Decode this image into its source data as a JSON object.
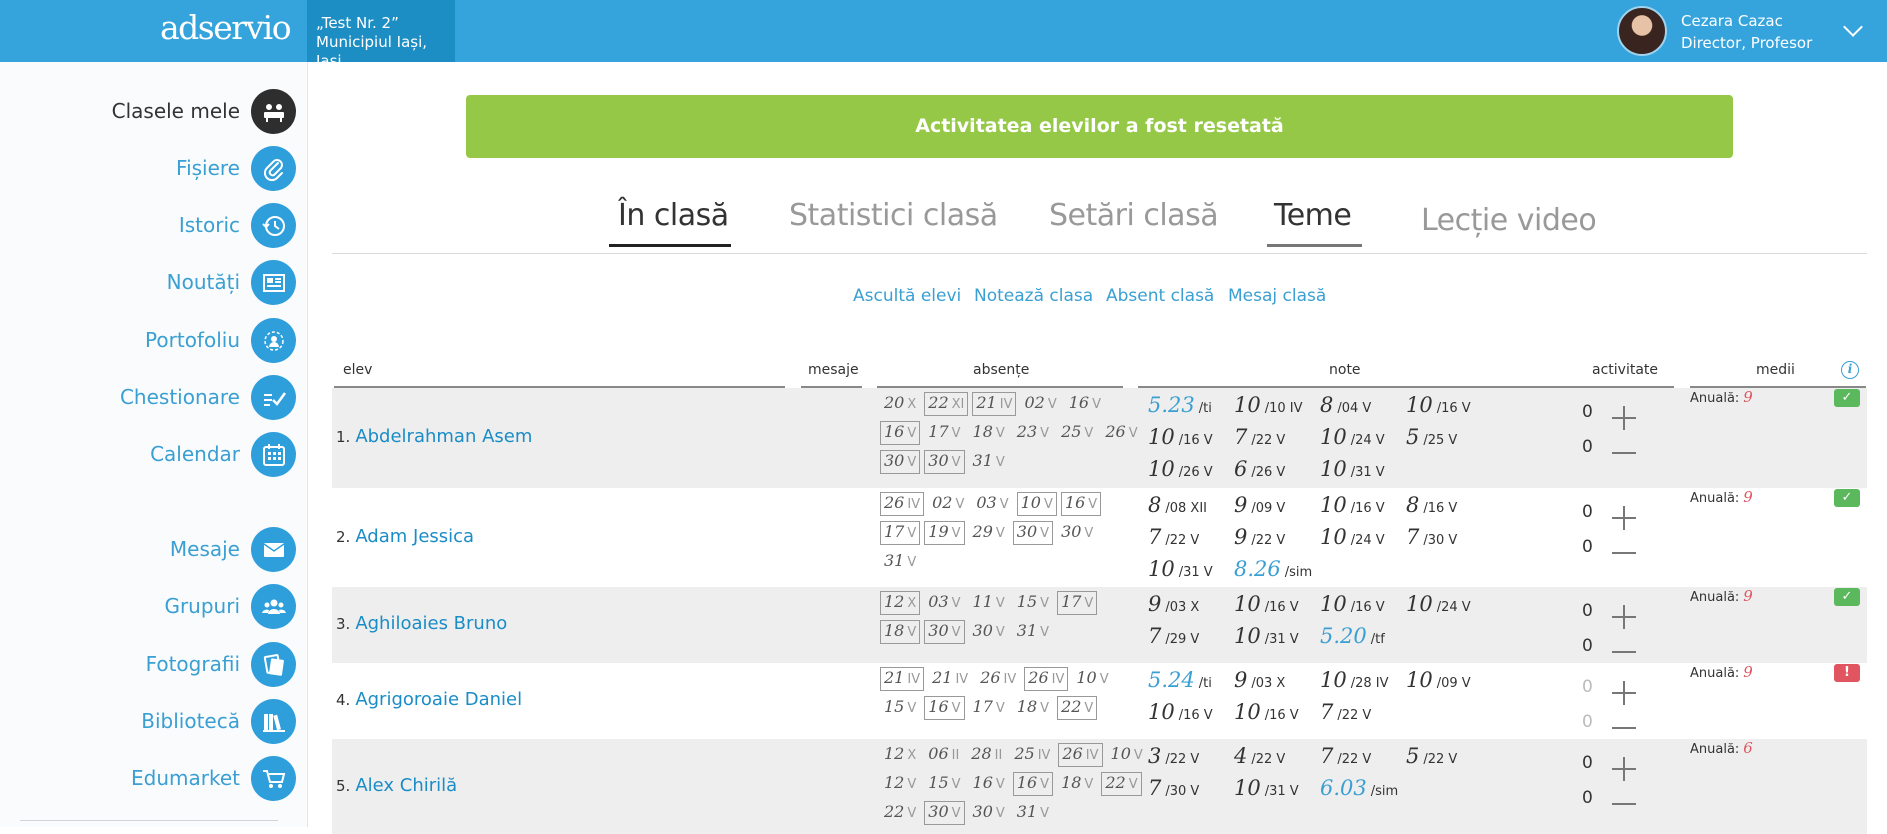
{
  "app": {
    "logo": "adservio",
    "school_line1": "„Test Nr. 2”",
    "school_line2": "Municipiul Iași, Iași"
  },
  "user": {
    "name": "Cezara Cazac",
    "role": "Director, Profesor"
  },
  "sidebar": {
    "items": [
      {
        "label": "Clasele mele",
        "icon": "classes-icon",
        "active": true
      },
      {
        "label": "Fișiere",
        "icon": "paperclip-icon"
      },
      {
        "label": "Istoric",
        "icon": "history-icon"
      },
      {
        "label": "Noutăți",
        "icon": "news-icon"
      },
      {
        "label": "Portofoliu",
        "icon": "portfolio-icon"
      },
      {
        "label": "Chestionare",
        "icon": "questionnaire-icon"
      },
      {
        "label": "Calendar",
        "icon": "calendar-icon"
      },
      {
        "label": "Mesaje",
        "icon": "envelope-icon"
      },
      {
        "label": "Grupuri",
        "icon": "group-icon"
      },
      {
        "label": "Fotografii",
        "icon": "photos-icon"
      },
      {
        "label": "Bibliotecă",
        "icon": "library-icon"
      },
      {
        "label": "Edumarket",
        "icon": "cart-icon"
      }
    ]
  },
  "banner": "Activitatea elevilor a fost resetată",
  "tabs": [
    "În clasă",
    "Statistici clasă",
    "Setări clasă",
    "Teme",
    "Lecție video"
  ],
  "actions": [
    "Ascultă elevi",
    "Notează clasa",
    "Absent clasă",
    "Mesaj clasă"
  ],
  "table": {
    "headers": {
      "elev": "elev",
      "mesaje": "mesaje",
      "absente": "absențe",
      "note": "note",
      "activitate": "activitate",
      "medii": "medii"
    }
  },
  "colors": {
    "accent": "#35a4dc",
    "success": "#95c847",
    "warning": "#e05560"
  },
  "students": [
    {
      "index": "1.",
      "name": "Abdelrahman Asem",
      "absences": [
        [
          {
            "d": "20",
            "m": "X",
            "b": false
          },
          {
            "d": "22",
            "m": "XI",
            "b": true
          },
          {
            "d": "21",
            "m": "IV",
            "b": true
          },
          {
            "d": "02",
            "m": "V",
            "b": false
          },
          {
            "d": "16",
            "m": "V",
            "b": false
          }
        ],
        [
          {
            "d": "16",
            "m": "V",
            "b": true
          },
          {
            "d": "17",
            "m": "V",
            "b": false
          },
          {
            "d": "18",
            "m": "V",
            "b": false
          },
          {
            "d": "23",
            "m": "V",
            "b": false
          },
          {
            "d": "25",
            "m": "V",
            "b": false
          },
          {
            "d": "26",
            "m": "V",
            "b": false
          }
        ],
        [
          {
            "d": "30",
            "m": "V",
            "b": true
          },
          {
            "d": "30",
            "m": "V",
            "b": true
          },
          {
            "d": "31",
            "m": "V",
            "b": false
          }
        ]
      ],
      "grades": [
        [
          {
            "v": "5.23",
            "s": "/ti",
            "blue": true
          },
          {
            "v": "10",
            "s": "/10 IV"
          },
          {
            "v": "8",
            "s": "/04 V"
          },
          {
            "v": "10",
            "s": "/16 V"
          }
        ],
        [
          {
            "v": "10",
            "s": "/16 V"
          },
          {
            "v": "7",
            "s": "/22 V"
          },
          {
            "v": "10",
            "s": "/24 V"
          },
          {
            "v": "5",
            "s": "/25 V"
          }
        ],
        [
          {
            "v": "10",
            "s": "/26 V"
          },
          {
            "v": "6",
            "s": "/26 V"
          },
          {
            "v": "10",
            "s": "/31 V"
          }
        ]
      ],
      "activity": [
        "0",
        "0"
      ],
      "activity_dim": false,
      "media_label": "Anuală:",
      "media": "9",
      "status": "ok"
    },
    {
      "index": "2.",
      "name": "Adam Jessica",
      "absences": [
        [
          {
            "d": "26",
            "m": "IV",
            "b": true
          },
          {
            "d": "02",
            "m": "V",
            "b": false
          },
          {
            "d": "03",
            "m": "V",
            "b": false
          },
          {
            "d": "10",
            "m": "V",
            "b": true
          },
          {
            "d": "16",
            "m": "V",
            "b": true
          }
        ],
        [
          {
            "d": "17",
            "m": "V",
            "b": true
          },
          {
            "d": "19",
            "m": "V",
            "b": true
          },
          {
            "d": "29",
            "m": "V",
            "b": false
          },
          {
            "d": "30",
            "m": "V",
            "b": true
          },
          {
            "d": "30",
            "m": "V",
            "b": false
          }
        ],
        [
          {
            "d": "31",
            "m": "V",
            "b": false
          }
        ]
      ],
      "grades": [
        [
          {
            "v": "8",
            "s": "/08 XII"
          },
          {
            "v": "9",
            "s": "/09 V"
          },
          {
            "v": "10",
            "s": "/16 V"
          },
          {
            "v": "8",
            "s": "/16 V"
          }
        ],
        [
          {
            "v": "7",
            "s": "/22 V"
          },
          {
            "v": "9",
            "s": "/22 V"
          },
          {
            "v": "10",
            "s": "/24 V"
          },
          {
            "v": "7",
            "s": "/30 V"
          }
        ],
        [
          {
            "v": "10",
            "s": "/31 V"
          },
          {
            "v": "8.26",
            "s": "/sim",
            "blue": true
          }
        ]
      ],
      "activity": [
        "0",
        "0"
      ],
      "activity_dim": false,
      "media_label": "Anuală:",
      "media": "9",
      "status": "ok"
    },
    {
      "index": "3.",
      "name": "Aghiloaies Bruno",
      "absences": [
        [
          {
            "d": "12",
            "m": "X",
            "b": true
          },
          {
            "d": "03",
            "m": "V",
            "b": false
          },
          {
            "d": "11",
            "m": "V",
            "b": false
          },
          {
            "d": "15",
            "m": "V",
            "b": false
          },
          {
            "d": "17",
            "m": "V",
            "b": true
          }
        ],
        [
          {
            "d": "18",
            "m": "V",
            "b": true
          },
          {
            "d": "30",
            "m": "V",
            "b": true
          },
          {
            "d": "30",
            "m": "V",
            "b": false
          },
          {
            "d": "31",
            "m": "V",
            "b": false
          }
        ]
      ],
      "grades": [
        [
          {
            "v": "9",
            "s": "/03 X"
          },
          {
            "v": "10",
            "s": "/16 V"
          },
          {
            "v": "10",
            "s": "/16 V"
          },
          {
            "v": "10",
            "s": "/24 V"
          }
        ],
        [
          {
            "v": "7",
            "s": "/29 V"
          },
          {
            "v": "10",
            "s": "/31 V"
          },
          {
            "v": "5.20",
            "s": "/tf",
            "blue": true
          }
        ]
      ],
      "activity": [
        "0",
        "0"
      ],
      "activity_dim": false,
      "media_label": "Anuală:",
      "media": "9",
      "status": "ok"
    },
    {
      "index": "4.",
      "name": "Agrigoroaie Daniel",
      "absences": [
        [
          {
            "d": "21",
            "m": "IV",
            "b": true
          },
          {
            "d": "21",
            "m": "IV",
            "b": false
          },
          {
            "d": "26",
            "m": "IV",
            "b": false
          },
          {
            "d": "26",
            "m": "IV",
            "b": true
          },
          {
            "d": "10",
            "m": "V",
            "b": false
          }
        ],
        [
          {
            "d": "15",
            "m": "V",
            "b": false
          },
          {
            "d": "16",
            "m": "V",
            "b": true
          },
          {
            "d": "17",
            "m": "V",
            "b": false
          },
          {
            "d": "18",
            "m": "V",
            "b": false
          },
          {
            "d": "22",
            "m": "V",
            "b": true
          }
        ]
      ],
      "grades": [
        [
          {
            "v": "5.24",
            "s": "/ti",
            "blue": true
          },
          {
            "v": "9",
            "s": "/03 X"
          },
          {
            "v": "10",
            "s": "/28 IV"
          },
          {
            "v": "10",
            "s": "/09 V"
          }
        ],
        [
          {
            "v": "10",
            "s": "/16 V"
          },
          {
            "v": "10",
            "s": "/16 V"
          },
          {
            "v": "7",
            "s": "/22 V"
          }
        ]
      ],
      "activity": [
        "0",
        "0"
      ],
      "activity_dim": true,
      "media_label": "Anuală:",
      "media": "9",
      "status": "warn"
    },
    {
      "index": "5.",
      "name": "Alex Chirilă",
      "absences": [
        [
          {
            "d": "12",
            "m": "X",
            "b": false
          },
          {
            "d": "06",
            "m": "II",
            "b": false
          },
          {
            "d": "28",
            "m": "II",
            "b": false
          },
          {
            "d": "25",
            "m": "IV",
            "b": false
          },
          {
            "d": "26",
            "m": "IV",
            "b": true
          },
          {
            "d": "10",
            "m": "V",
            "b": false
          }
        ],
        [
          {
            "d": "12",
            "m": "V",
            "b": false
          },
          {
            "d": "15",
            "m": "V",
            "b": false
          },
          {
            "d": "16",
            "m": "V",
            "b": false
          },
          {
            "d": "16",
            "m": "V",
            "b": true
          },
          {
            "d": "18",
            "m": "V",
            "b": false
          },
          {
            "d": "22",
            "m": "V",
            "b": true
          }
        ],
        [
          {
            "d": "22",
            "m": "V",
            "b": false
          },
          {
            "d": "30",
            "m": "V",
            "b": true
          },
          {
            "d": "30",
            "m": "V",
            "b": false
          },
          {
            "d": "31",
            "m": "V",
            "b": false
          }
        ]
      ],
      "grades": [
        [
          {
            "v": "3",
            "s": "/22 V"
          },
          {
            "v": "4",
            "s": "/22 V"
          },
          {
            "v": "7",
            "s": "/22 V"
          },
          {
            "v": "5",
            "s": "/22 V"
          }
        ],
        [
          {
            "v": "7",
            "s": "/30 V"
          },
          {
            "v": "10",
            "s": "/31 V"
          },
          {
            "v": "6.03",
            "s": "/sim",
            "blue": true
          }
        ]
      ],
      "activity": [
        "0",
        "0"
      ],
      "activity_dim": false,
      "media_label": "Anuală:",
      "media": "6",
      "status": ""
    }
  ]
}
